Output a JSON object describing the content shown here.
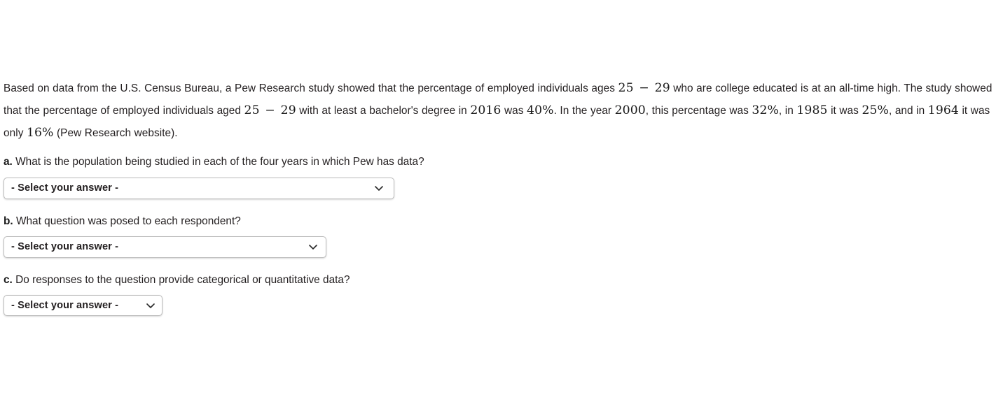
{
  "problem": {
    "segments": [
      {
        "type": "text",
        "value": "Based on data from the U.S. Census Bureau, a Pew Research study showed that the percentage of employed individuals ages "
      },
      {
        "type": "math",
        "value": "25 − 29"
      },
      {
        "type": "text",
        "value": " who are college educated is at an all-time high. The study showed that the percentage of employed individuals aged "
      },
      {
        "type": "math",
        "value": "25 − 29"
      },
      {
        "type": "text",
        "value": " with at least a bachelor's degree in "
      },
      {
        "type": "math",
        "value": "2016"
      },
      {
        "type": "text",
        "value": " was "
      },
      {
        "type": "math",
        "value": "40%"
      },
      {
        "type": "text",
        "value": ". In the year "
      },
      {
        "type": "math",
        "value": "2000"
      },
      {
        "type": "text",
        "value": ", this percentage was "
      },
      {
        "type": "math",
        "value": "32%"
      },
      {
        "type": "text",
        "value": ", in "
      },
      {
        "type": "math",
        "value": "1985"
      },
      {
        "type": "text",
        "value": " it was "
      },
      {
        "type": "math",
        "value": "25%"
      },
      {
        "type": "text",
        "value": ", and in "
      },
      {
        "type": "math",
        "value": "1964"
      },
      {
        "type": "text",
        "value": " it was only "
      },
      {
        "type": "math",
        "value": "16%"
      },
      {
        "type": "text",
        "value": " (Pew Research website)."
      }
    ],
    "text_plain": "Based on data from the U.S. Census Bureau, a Pew Research study showed that the percentage of employed individuals ages 25 − 29 who are college educated is at an all-time high. The study showed that the percentage of employed individuals aged 25 − 29 with at least a bachelor's degree in 2016 was 40%. In the year 2000, this percentage was 32%, in 1985 it was 25%, and in 1964 it was only 16% (Pew Research website).",
    "source_note": "(Pew Research website)."
  },
  "questions": [
    {
      "marker": "a.",
      "prompt": "What is the population being studied in each of the four years in which Pew has data?",
      "answer": {
        "selected": "- Select your answer -",
        "placeholder": "- Select your answer -",
        "chevron_icon": "chevron-down-icon"
      }
    },
    {
      "marker": "b.",
      "prompt": "What question was posed to each respondent?",
      "answer": {
        "selected": "- Select your answer -",
        "placeholder": "- Select your answer -",
        "chevron_icon": "chevron-down-icon"
      }
    },
    {
      "marker": "c.",
      "prompt": "Do responses to the question provide categorical or quantitative data?",
      "answer": {
        "selected": "- Select your answer -",
        "placeholder": "- Select your answer -",
        "chevron_icon": "chevron-down-icon"
      }
    }
  ],
  "colors": {
    "background": "#ffffff",
    "body_text": "#231f20",
    "math_text": "#1a1a1a",
    "select_border": "#bcbcbc",
    "select_background": "#ffffff"
  }
}
